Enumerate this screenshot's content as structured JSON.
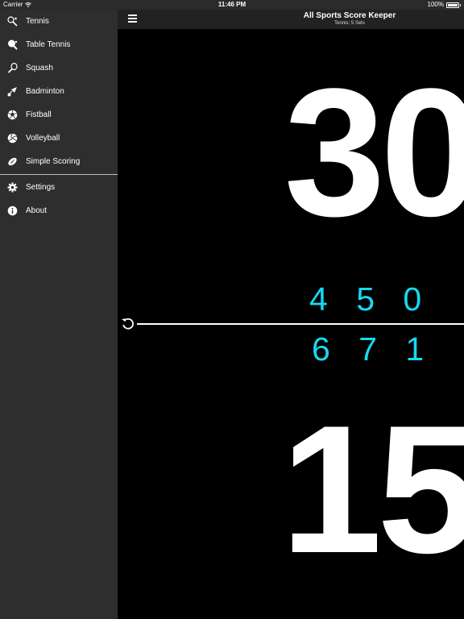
{
  "status_bar": {
    "carrier": "Carrier",
    "time": "11:46 PM",
    "battery": "100%"
  },
  "sidebar": {
    "items": [
      {
        "label": "Tennis",
        "icon": "tennis-icon"
      },
      {
        "label": "Table Tennis",
        "icon": "table-tennis-icon"
      },
      {
        "label": "Squash",
        "icon": "squash-icon"
      },
      {
        "label": "Badminton",
        "icon": "badminton-icon"
      },
      {
        "label": "Fistball",
        "icon": "fistball-icon"
      },
      {
        "label": "Volleyball",
        "icon": "volleyball-icon"
      },
      {
        "label": "Simple Scoring",
        "icon": "rugby-ball-icon"
      }
    ],
    "bottom_items": [
      {
        "label": "Settings",
        "icon": "gear-icon"
      },
      {
        "label": "About",
        "icon": "info-icon"
      }
    ]
  },
  "header": {
    "title": "All Sports Score Keeper",
    "subtitle": "Tennis; 5 Sets"
  },
  "scoreboard": {
    "player1": {
      "points": "30",
      "games": "4 5 0"
    },
    "player2": {
      "points": "15",
      "games": "6 7 1"
    }
  },
  "colors": {
    "accent": "#16d9f0",
    "background": "#000000",
    "sidebar": "#2e2e2e"
  }
}
